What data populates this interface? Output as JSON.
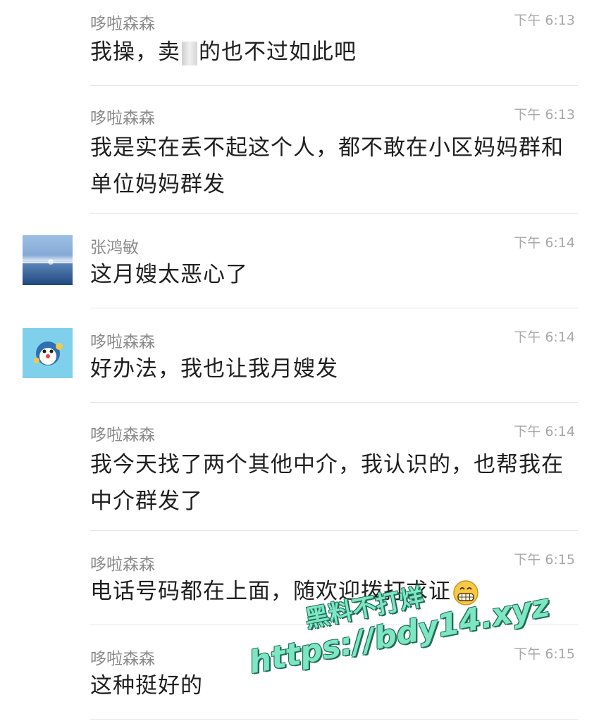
{
  "messages": [
    {
      "sender": "哆啦森森",
      "time": "下午 6:13",
      "text_a": "我操，卖",
      "text_b": "的也不过如此吧",
      "avatar": "none"
    },
    {
      "sender": "哆啦森森",
      "time": "下午 6:13",
      "text": "我是实在丢不起这个人，都不敢在小区妈妈群和单位妈妈群发",
      "avatar": "none"
    },
    {
      "sender": "张鸿敏",
      "time": "下午 6:14",
      "text": "这月嫂太恶心了",
      "avatar": "sea-photo"
    },
    {
      "sender": "哆啦森森",
      "time": "下午 6:14",
      "text": "好办法，我也让我月嫂发",
      "avatar": "cartoon"
    },
    {
      "sender": "哆啦森森",
      "time": "下午 6:14",
      "text": "我今天找了两个其他中介，我认识的，也帮我在中介群发了",
      "avatar": "none"
    },
    {
      "sender": "哆啦森森",
      "time": "下午 6:15",
      "text": "电话号码都在上面，随欢迎拨打求证",
      "emoji": "grinning-face",
      "avatar": "none"
    },
    {
      "sender": "哆啦森森",
      "time": "下午 6:15",
      "text": "这种挺好的",
      "avatar": "none"
    }
  ],
  "watermark": {
    "line1": "黑料不打烊",
    "line2": "https://bdy14.xyz",
    "color": "#7ee6c2"
  }
}
